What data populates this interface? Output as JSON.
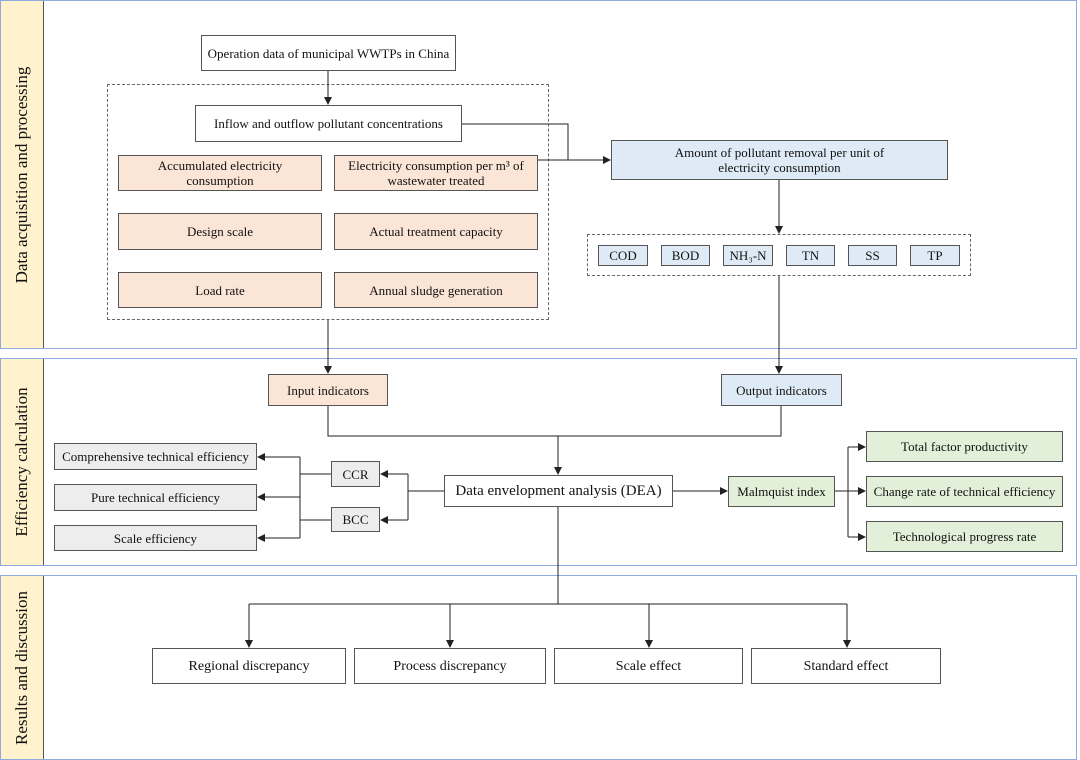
{
  "sections": {
    "acquisition": "Data acquisition and processing",
    "efficiency": "Efficiency calculation",
    "results": "Results and discussion"
  },
  "acquisition": {
    "source": "Operation data of municipal WWTPs in China",
    "inflow": "Inflow and outflow pollutant concentrations",
    "accumulated": "Accumulated electricity consumption",
    "per_m3": "Electricity consumption per m³ of wastewater treated",
    "design_scale": "Design scale",
    "actual_capacity": "Actual treatment capacity",
    "load_rate": "Load rate",
    "sludge": "Annual sludge generation",
    "removal": "Amount of pollutant removal per unit of electricity consumption",
    "pollutants": [
      "COD",
      "BOD",
      "NH₃-N",
      "TN",
      "SS",
      "TP"
    ]
  },
  "efficiency": {
    "input": "Input indicators",
    "output": "Output indicators",
    "dea": "Data envelopment analysis (DEA)",
    "ccr": "CCR",
    "bcc": "BCC",
    "comprehensive": "Comprehensive technical efficiency",
    "pure": "Pure technical efficiency",
    "scale": "Scale efficiency",
    "malmquist": "Malmquist index",
    "tfp": "Total factor productivity",
    "change_rate": "Change rate of technical efficiency",
    "tech_progress": "Technological progress rate"
  },
  "results": {
    "regional": "Regional discrepancy",
    "process": "Process discrepancy",
    "scale_effect": "Scale effect",
    "standard": "Standard effect"
  },
  "colors": {
    "input": "#fbe5d6",
    "output": "#deebf7",
    "malmquist": "#e2f0d9",
    "dea_results": "#ededed",
    "section_label": "#fff2cc",
    "section_border": "#8faadc"
  }
}
